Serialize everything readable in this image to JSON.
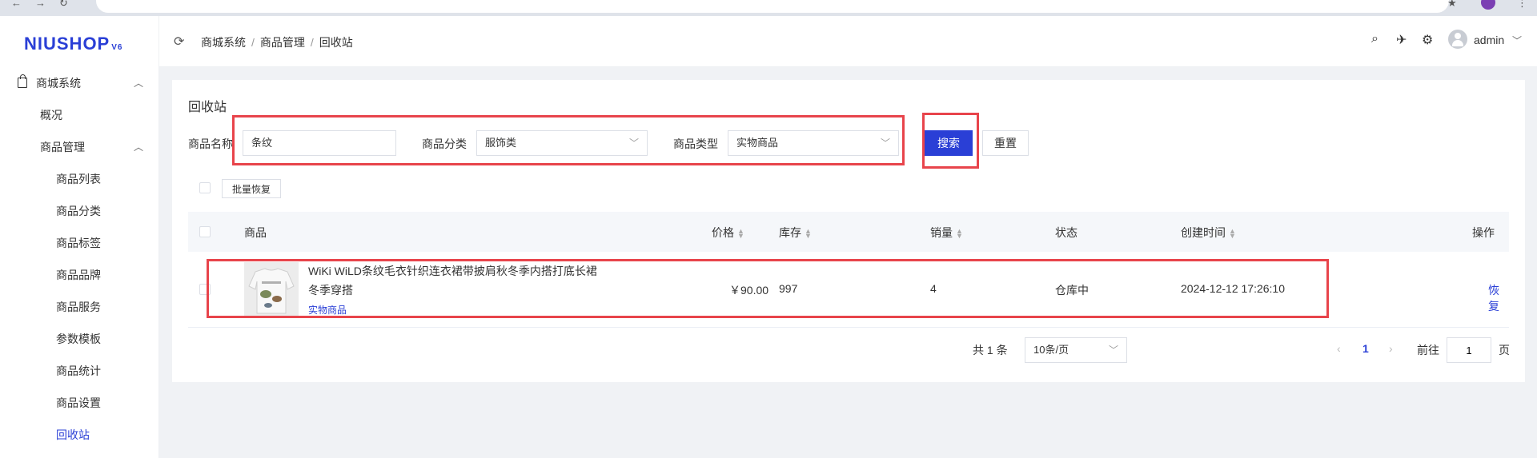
{
  "sidebar": {
    "logo": "NIUSHOP",
    "logo_version": "V6",
    "section": "商城系统",
    "items": [
      {
        "label": "概况"
      },
      {
        "label": "商品管理"
      },
      {
        "label": "商品列表"
      },
      {
        "label": "商品分类"
      },
      {
        "label": "商品标签"
      },
      {
        "label": "商品品牌"
      },
      {
        "label": "商品服务"
      },
      {
        "label": "参数模板"
      },
      {
        "label": "商品统计"
      },
      {
        "label": "商品设置"
      },
      {
        "label": "回收站",
        "active": true
      }
    ]
  },
  "header": {
    "breadcrumb": [
      "商城系统",
      "商品管理",
      "回收站"
    ],
    "user": "admin"
  },
  "main": {
    "title": "回收站",
    "filters": {
      "name_label": "商品名称",
      "name_value": "条纹",
      "category_label": "商品分类",
      "category_value": "服饰类",
      "type_label": "商品类型",
      "type_value": "实物商品"
    },
    "search_label": "搜索",
    "reset_label": "重置",
    "batch_restore_label": "批量恢复",
    "table": {
      "columns": [
        "商品",
        "价格",
        "库存",
        "销量",
        "状态",
        "创建时间",
        "操作"
      ],
      "rows": [
        {
          "name_line1": "WiKi WiLD条纹毛衣针织连衣裙带披肩秋冬季内搭打底长裙",
          "name_line2": "冬季穿搭",
          "type": "实物商品",
          "price": "￥90.00",
          "stock": "997",
          "sales": "4",
          "status": "仓库中",
          "created": "2024-12-12 17:26:10",
          "action": "恢复"
        }
      ]
    },
    "pagination": {
      "total": "共 1 条",
      "page_size": "10条/页",
      "current": "1",
      "goto_label": "前往",
      "goto_value": "1",
      "page_suffix": "页"
    }
  },
  "colors": {
    "accent": "#2a3fd6",
    "highlight": "#e8444b"
  }
}
